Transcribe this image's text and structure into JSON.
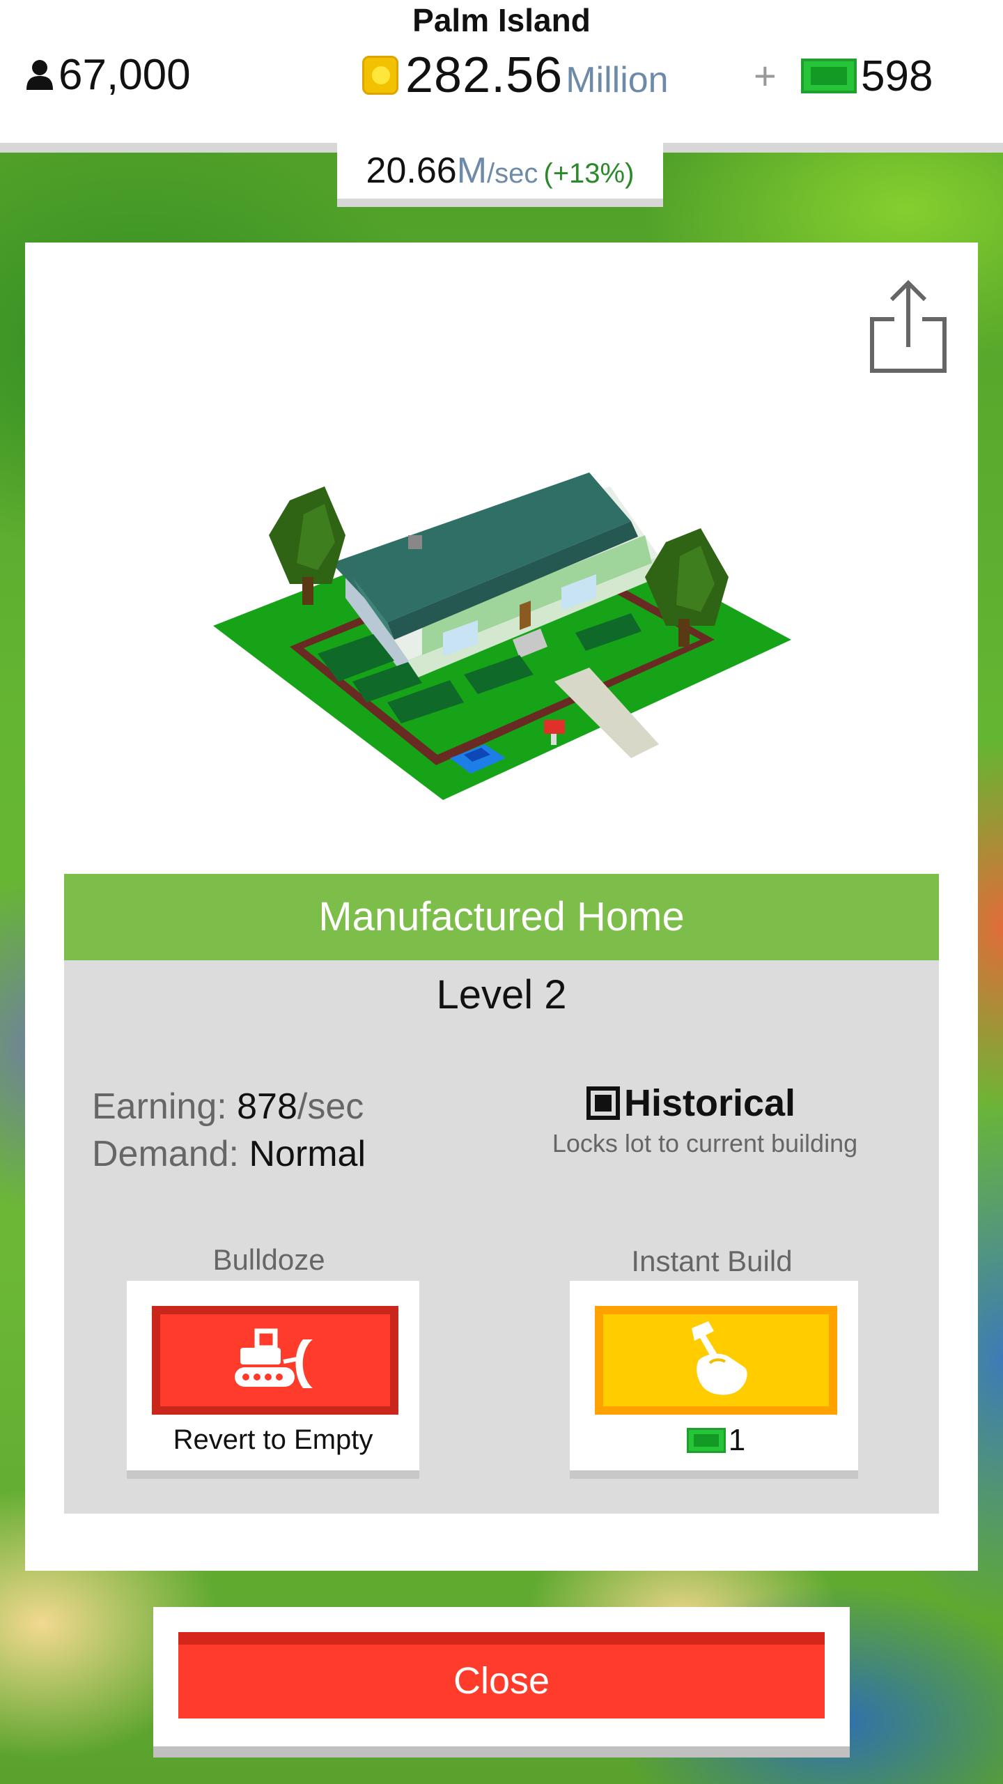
{
  "header": {
    "island_name": "Palm Island",
    "population": "67,000",
    "money_value": "282.56",
    "money_unit": "Million",
    "plus_label": "+",
    "cash": "598"
  },
  "rate": {
    "value": "20.66",
    "unit_m": "M",
    "unit_sec": "/sec",
    "bonus": "(+13%)"
  },
  "building": {
    "name": "Manufactured Home",
    "level": "Level 2",
    "earning_label": "Earning:",
    "earning_value": "878",
    "earning_unit": "/sec",
    "demand_label": "Demand:",
    "demand_value": "Normal"
  },
  "historical": {
    "label": "Historical",
    "description": "Locks lot to current building",
    "checked": true
  },
  "actions": {
    "bulldoze_title": "Bulldoze",
    "bulldoze_caption": "Revert to Empty",
    "instant_build_title": "Instant Build",
    "instant_build_cost": "1"
  },
  "footer": {
    "close_label": "Close"
  },
  "colors": {
    "accent_green": "#7dbd4a",
    "danger_red": "#ff3b2b",
    "build_yellow": "#ffcc00"
  }
}
